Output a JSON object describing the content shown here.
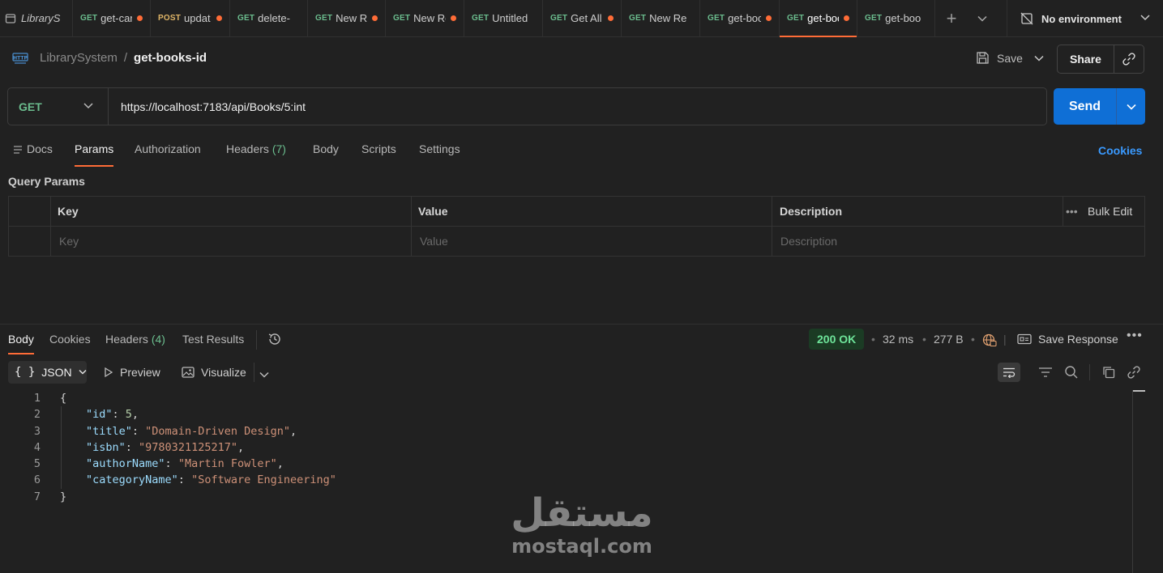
{
  "workspace": {
    "name": "LibraryS"
  },
  "tabs": [
    {
      "method": "GET",
      "name": "get-car",
      "unsaved": true,
      "active": false
    },
    {
      "method": "POST",
      "name": "updat",
      "unsaved": true,
      "active": false
    },
    {
      "method": "GET",
      "name": "delete-",
      "unsaved": false,
      "active": false
    },
    {
      "method": "GET",
      "name": "New Re",
      "unsaved": true,
      "active": false
    },
    {
      "method": "GET",
      "name": "New Re",
      "unsaved": true,
      "active": false
    },
    {
      "method": "GET",
      "name": "Untitled",
      "unsaved": false,
      "active": false
    },
    {
      "method": "GET",
      "name": "Get All",
      "unsaved": true,
      "active": false
    },
    {
      "method": "GET",
      "name": "New Re",
      "unsaved": false,
      "active": false
    },
    {
      "method": "GET",
      "name": "get-boo",
      "unsaved": true,
      "active": false
    },
    {
      "method": "GET",
      "name": "get-boo",
      "unsaved": true,
      "active": true
    },
    {
      "method": "GET",
      "name": "get-boo",
      "unsaved": false,
      "active": false
    }
  ],
  "environment": {
    "label": "No environment"
  },
  "breadcrumb": {
    "collection": "LibrarySystem",
    "separator": "/",
    "request": "get-books-id"
  },
  "actions": {
    "save": "Save",
    "share": "Share"
  },
  "request": {
    "method": "GET",
    "url": "https://localhost:7183/api/Books/5:int",
    "send": "Send"
  },
  "request_tabs": {
    "docs": "Docs",
    "params": "Params",
    "authorization": "Authorization",
    "headers": "Headers",
    "headers_count": "(7)",
    "body": "Body",
    "scripts": "Scripts",
    "settings": "Settings",
    "cookies": "Cookies"
  },
  "query_params": {
    "title": "Query Params",
    "headers": {
      "key": "Key",
      "value": "Value",
      "description": "Description",
      "bulk_edit": "Bulk Edit"
    },
    "placeholders": {
      "key": "Key",
      "value": "Value",
      "description": "Description"
    }
  },
  "response": {
    "tabs": {
      "body": "Body",
      "cookies": "Cookies",
      "headers": "Headers",
      "headers_count": "(4)",
      "test_results": "Test Results"
    },
    "status": "200 OK",
    "time": "32 ms",
    "size": "277 B",
    "save_response": "Save Response",
    "format": "JSON",
    "preview": "Preview",
    "visualize": "Visualize",
    "line_numbers": [
      "1",
      "2",
      "3",
      "4",
      "5",
      "6",
      "7"
    ],
    "json_lines": {
      "open": "{",
      "id_key": "\"id\"",
      "id_val": "5",
      "title_key": "\"title\"",
      "title_val": "\"Domain-Driven Design\"",
      "isbn_key": "\"isbn\"",
      "isbn_val": "\"9780321125217\"",
      "author_key": "\"authorName\"",
      "author_val": "\"Martin Fowler\"",
      "category_key": "\"categoryName\"",
      "category_val": "\"Software Engineering\"",
      "close": "}"
    }
  },
  "watermark": {
    "arabic": "مستقل",
    "latin": "mostaql.com"
  },
  "colors": {
    "accent": "#ff6c37",
    "send": "#0f6fd6",
    "get": "#6bbd8e",
    "post": "#e0b567",
    "status_ok": "#6ee49a",
    "link": "#3a9aff"
  }
}
